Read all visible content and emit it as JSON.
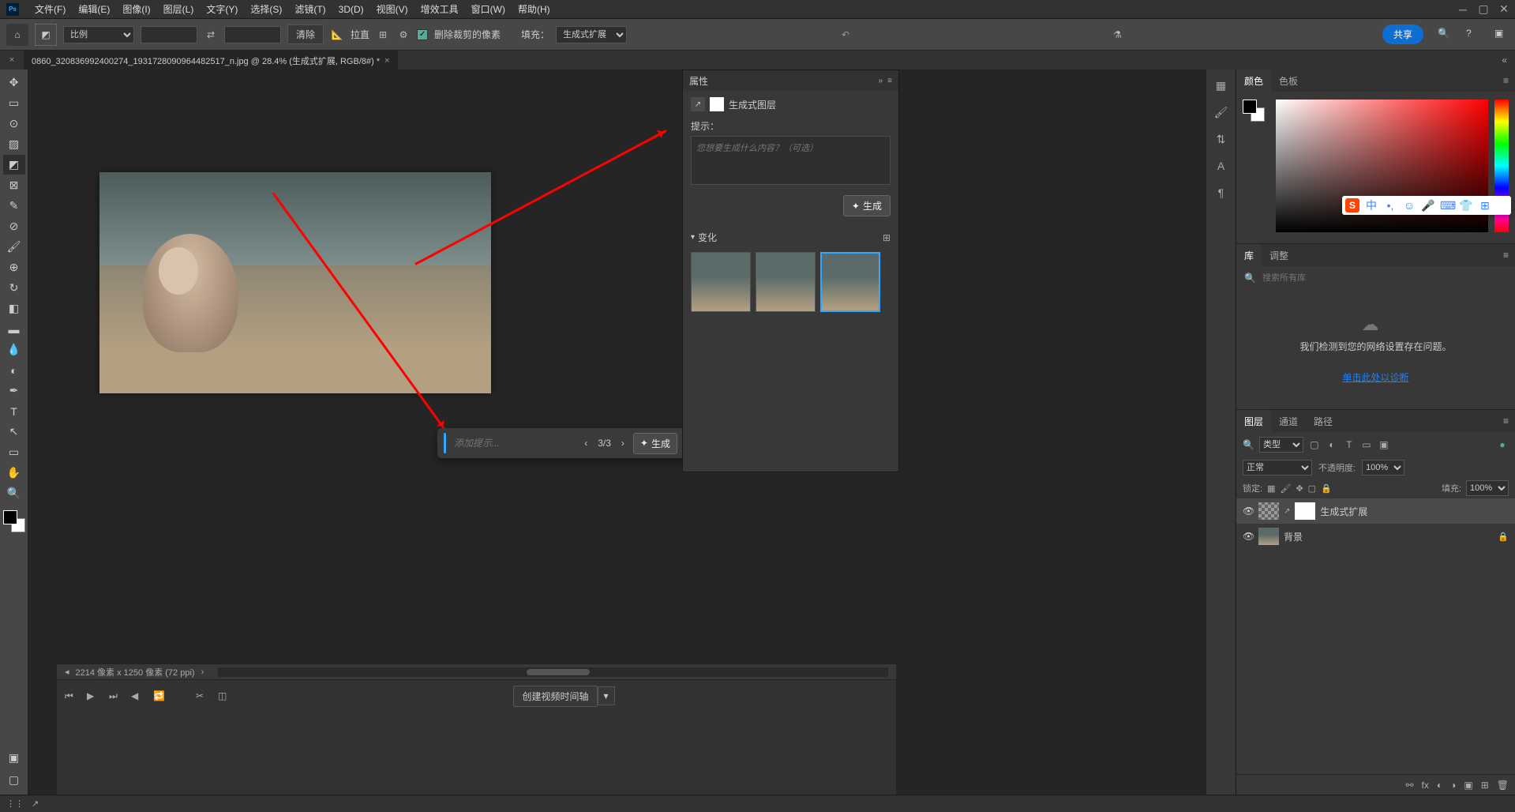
{
  "menu": {
    "items": [
      "文件(F)",
      "编辑(E)",
      "图像(I)",
      "图层(L)",
      "文字(Y)",
      "选择(S)",
      "滤镜(T)",
      "3D(D)",
      "视图(V)",
      "增效工具",
      "窗口(W)",
      "帮助(H)"
    ]
  },
  "optbar": {
    "ratio_mode": "比例",
    "clear": "清除",
    "straighten": "拉直",
    "delete_crop": "删除裁剪的像素",
    "fill_label": "填充：",
    "fill_mode": "生成式扩展",
    "share": "共享"
  },
  "doc": {
    "tab_title": "0860_320836992400274_1931728090964482517_n.jpg @ 28.4% (生成式扩展, RGB/8#) *"
  },
  "prompt": {
    "placeholder": "添加提示...",
    "counter": "3/3",
    "generate": "生成"
  },
  "props": {
    "title": "属性",
    "layer_type": "生成式图层",
    "hint_label": "提示：",
    "textarea_placeholder": "您想要生成什么内容？（可选）",
    "generate": "生成",
    "variations_label": "变化"
  },
  "right": {
    "color_tabs": [
      "颜色",
      "色板"
    ],
    "lib_tabs": [
      "库",
      "调整"
    ],
    "lib_search_placeholder": "搜索所有库",
    "lib_msg": "我们检测到您的网络设置存在问题。",
    "lib_link": "单击此处以诊断",
    "layers_tabs": [
      "图层",
      "通道",
      "路径"
    ],
    "filter_kind": "类型",
    "blend_mode": "正常",
    "opacity_label": "不透明度:",
    "opacity_value": "100%",
    "lock_label": "锁定:",
    "fill_label": "填充:",
    "fill_value": "100%",
    "layer_items": [
      {
        "name": "生成式扩展",
        "selected": true,
        "hasMask": true
      },
      {
        "name": "背景",
        "selected": false,
        "locked": true
      }
    ]
  },
  "status": {
    "info": "2214 像素 x 1250 像素 (72 ppi)",
    "timeline_btn": "创建视频时间轴"
  },
  "ime_lang": "中"
}
